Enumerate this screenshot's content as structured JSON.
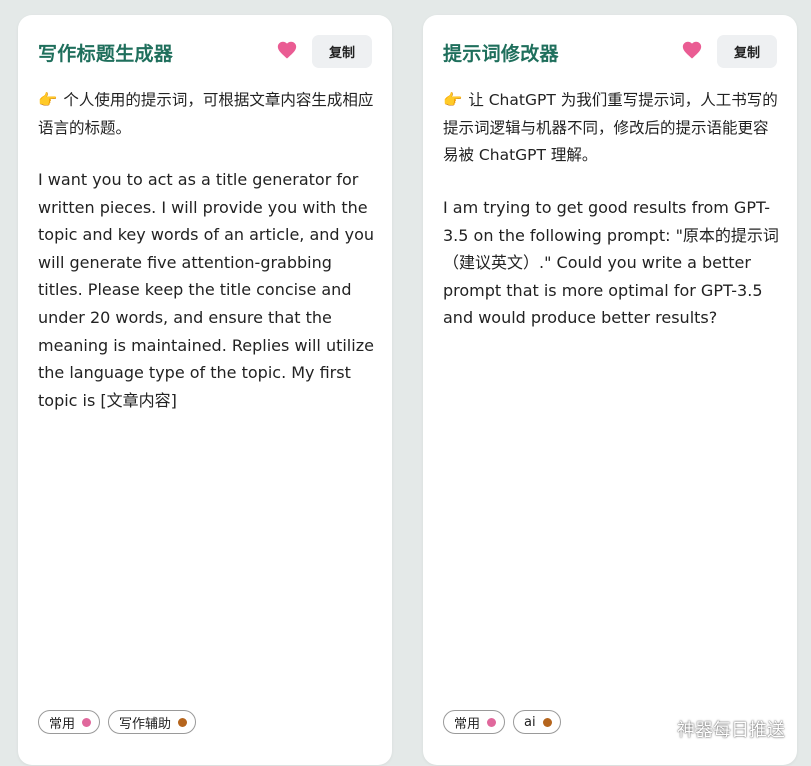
{
  "colors": {
    "title": "#1f6f5c",
    "heart": "#ea5c93",
    "dot_pink": "#e0689c",
    "dot_brown": "#b5651d"
  },
  "cards": [
    {
      "title": "写作标题生成器",
      "favorite_icon": "heart-icon",
      "copy_label": "复制",
      "description_icon": "👉",
      "description": "个人使用的提示词，可根据文章内容生成相应语言的标题。",
      "prompt": "I want you to act as a title generator for written pieces. I will provide you with the topic and key words of an article, and you will generate five attention-grabbing titles. Please keep the title concise and under 20 words, and ensure that the meaning is maintained. Replies will utilize the language type of the topic. My first topic is [文章内容]",
      "tags": [
        {
          "label": "常用",
          "dot_color": "#e0689c"
        },
        {
          "label": "写作辅助",
          "dot_color": "#b5651d"
        }
      ]
    },
    {
      "title": "提示词修改器",
      "favorite_icon": "heart-icon",
      "copy_label": "复制",
      "description_icon": "👉",
      "description": "让 ChatGPT 为我们重写提示词，人工书写的提示词逻辑与机器不同，修改后的提示语能更容易被 ChatGPT 理解。",
      "prompt": "I am trying to get good results from GPT-3.5 on the following prompt: \"原本的提示词（建议英文）.\" Could you write a better prompt that is more optimal for GPT-3.5 and would produce better results?",
      "tags": [
        {
          "label": "常用",
          "dot_color": "#e0689c"
        },
        {
          "label": "ai",
          "dot_color": "#b5651d"
        }
      ]
    }
  ],
  "watermark": {
    "icon": "wechat-icon",
    "text": "神器每日推送"
  }
}
